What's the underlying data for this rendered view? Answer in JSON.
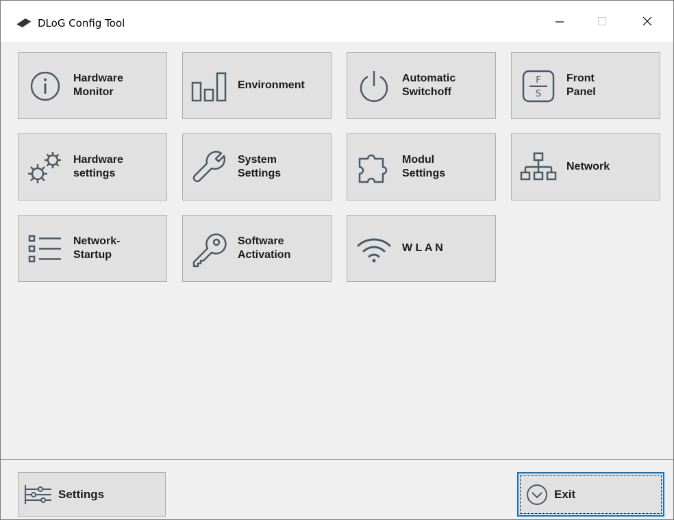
{
  "window": {
    "title": "DLoG Config Tool",
    "accent_color": "#0078d7",
    "icon_color": "#4a5a66"
  },
  "tiles": [
    {
      "label": "Hardware\nMonitor",
      "icon": "info-circle-icon"
    },
    {
      "label": "Environment",
      "icon": "bar-chart-icon"
    },
    {
      "label": "Automatic\nSwitchoff",
      "icon": "power-icon"
    },
    {
      "label": "Front\nPanel",
      "icon": "front-panel-icon"
    },
    {
      "label": "Hardware\nsettings",
      "icon": "gears-icon"
    },
    {
      "label": "System\nSettings",
      "icon": "wrench-icon"
    },
    {
      "label": "Modul\nSettings",
      "icon": "puzzle-icon"
    },
    {
      "label": "Network",
      "icon": "network-icon"
    },
    {
      "label": "Network-\nStartup",
      "icon": "list-icon"
    },
    {
      "label": "Software\nActivation",
      "icon": "key-icon"
    },
    {
      "label": "W L A N",
      "icon": "wifi-icon"
    }
  ],
  "footer": {
    "settings_label": "Settings",
    "settings_icon": "sliders-icon",
    "exit_label": "Exit",
    "exit_icon": "chevron-circle-icon"
  }
}
